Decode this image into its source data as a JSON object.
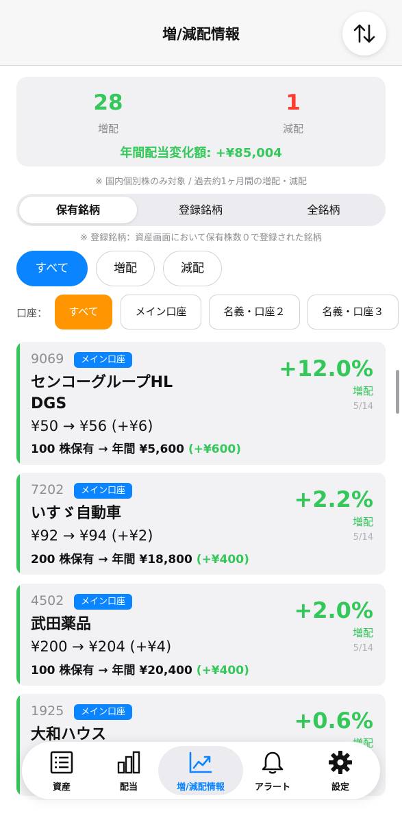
{
  "header": {
    "title": "増/減配情報",
    "sort_icon": "sort-arrows-icon"
  },
  "summary": {
    "increase_count": "28",
    "increase_label": "増配",
    "decrease_count": "1",
    "decrease_label": "減配",
    "annual_change": "年間配当変化額: +¥85,004",
    "colors": {
      "increase": "#34c759",
      "decrease": "#ff3b30"
    }
  },
  "note1": "※ 国内個別株のみ対象 / 過去約1ヶ月間の増配・減配",
  "segment": {
    "items": [
      "保有銘柄",
      "登録銘柄",
      "全銘柄"
    ],
    "selected": "保有銘柄"
  },
  "note2": "※ 登録銘柄：資産画面において保有株数０で登録された銘柄",
  "filters": {
    "items": [
      "すべて",
      "増配",
      "減配"
    ],
    "selected": "すべて"
  },
  "accounts": {
    "label": "口座：",
    "items": [
      "すべて",
      "メイン口座",
      "名義・口座２",
      "名義・口座３"
    ],
    "selected": "すべて"
  },
  "cards": [
    {
      "code": "9069",
      "account": "メイン口座",
      "name": "センコーグループHL DGS",
      "price": "¥50 → ¥56 (+¥6)",
      "holding": "100 株保有 → 年間 ¥5,600",
      "diff": "(+¥600)",
      "pct": "+12.0%",
      "tag": "増配",
      "date": "5/14"
    },
    {
      "code": "7202",
      "account": "メイン口座",
      "name": "いすゞ自動車",
      "price": "¥92 → ¥94 (+¥2)",
      "holding": "200 株保有 → 年間 ¥18,800",
      "diff": "(+¥400)",
      "pct": "+2.2%",
      "tag": "増配",
      "date": "5/14"
    },
    {
      "code": "4502",
      "account": "メイン口座",
      "name": "武田薬品",
      "price": "¥200 → ¥204 (+¥4)",
      "holding": "100 株保有 → 年間 ¥20,400",
      "diff": "(+¥400)",
      "pct": "+2.0%",
      "tag": "増配",
      "date": "5/14"
    },
    {
      "code": "1925",
      "account": "メイン口座",
      "name": "大和ハウス",
      "pct": "+0.6%",
      "tag": "増配"
    }
  ],
  "tabbar": {
    "items": [
      {
        "label": "資産",
        "icon": "list-icon"
      },
      {
        "label": "配当",
        "icon": "bar-chart-icon"
      },
      {
        "label": "増/減配情報",
        "icon": "trend-up-icon"
      },
      {
        "label": "アラート",
        "icon": "bell-icon"
      },
      {
        "label": "設定",
        "icon": "gear-icon"
      }
    ],
    "selected": "増/減配情報"
  }
}
